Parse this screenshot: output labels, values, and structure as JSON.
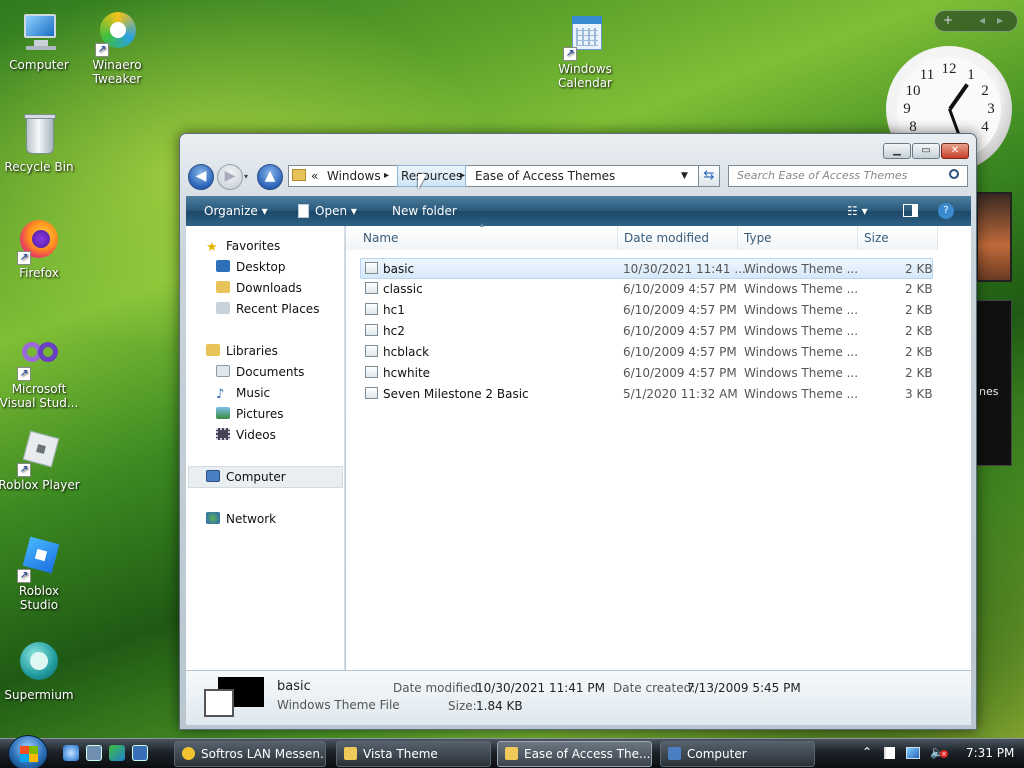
{
  "desktop": {
    "icons": [
      {
        "label": "Computer",
        "icon": "computer-icon"
      },
      {
        "label": "Winaero Tweaker",
        "icon": "winaero-icon"
      },
      {
        "label": "Windows Calendar",
        "icon": "calendar-icon"
      },
      {
        "label": "Recycle Bin",
        "icon": "recycle-bin-icon"
      },
      {
        "label": "Firefox",
        "icon": "firefox-icon"
      },
      {
        "label": "Microsoft Visual Stud...",
        "icon": "visual-studio-icon"
      },
      {
        "label": "Roblox Player",
        "icon": "roblox-player-icon"
      },
      {
        "label": "Roblox Studio",
        "icon": "roblox-studio-icon"
      },
      {
        "label": "Supermium",
        "icon": "supermium-icon"
      }
    ],
    "gadget_bar": {
      "add": "+",
      "prev": "◂",
      "next": "▸"
    },
    "clock_numbers": [
      "12",
      "1",
      "2",
      "3",
      "4",
      "8",
      "9",
      "10",
      "11"
    ],
    "side_gadget_text": "nes"
  },
  "window": {
    "caption_buttons": {
      "minimize": "▁",
      "maximize": "▭",
      "close": "✕"
    },
    "address": {
      "overflow": "«",
      "crumbs": [
        "Windows",
        "Resources",
        "Ease of Access Themes"
      ],
      "sep": "▸"
    },
    "search_placeholder": "Search Ease of Access Themes",
    "toolbar": {
      "organize": "Organize ▾",
      "open": "Open ▾",
      "new_folder": "New folder",
      "help": "?"
    },
    "nav": {
      "favorites": "Favorites",
      "favorites_items": [
        "Desktop",
        "Downloads",
        "Recent Places"
      ],
      "libraries": "Libraries",
      "libraries_items": [
        "Documents",
        "Music",
        "Pictures",
        "Videos"
      ],
      "computer": "Computer",
      "network": "Network"
    },
    "columns": [
      "Name",
      "Date modified",
      "Type",
      "Size"
    ],
    "files": [
      {
        "name": "basic",
        "date": "10/30/2021 11:41 ...",
        "type": "Windows Theme ...",
        "size": "2 KB"
      },
      {
        "name": "classic",
        "date": "6/10/2009 4:57 PM",
        "type": "Windows Theme ...",
        "size": "2 KB"
      },
      {
        "name": "hc1",
        "date": "6/10/2009 4:57 PM",
        "type": "Windows Theme ...",
        "size": "2 KB"
      },
      {
        "name": "hc2",
        "date": "6/10/2009 4:57 PM",
        "type": "Windows Theme ...",
        "size": "2 KB"
      },
      {
        "name": "hcblack",
        "date": "6/10/2009 4:57 PM",
        "type": "Windows Theme ...",
        "size": "2 KB"
      },
      {
        "name": "hcwhite",
        "date": "6/10/2009 4:57 PM",
        "type": "Windows Theme ...",
        "size": "2 KB"
      },
      {
        "name": "Seven Milestone 2 Basic",
        "date": "5/1/2020 11:32 AM",
        "type": "Windows Theme ...",
        "size": "3 KB"
      }
    ],
    "details": {
      "name": "basic",
      "type": "Windows Theme File",
      "modified_label": "Date modified:",
      "modified": "10/30/2021 11:41 PM",
      "created_label": "Date created:",
      "created": "7/13/2009 5:45 PM",
      "size_label": "Size:",
      "size": "1.84 KB"
    }
  },
  "taskbar": {
    "buttons": [
      {
        "label": "Softros LAN Messen...",
        "color": "#f2c230"
      },
      {
        "label": "Vista Theme",
        "color": "#f0c95a"
      },
      {
        "label": "Ease of Access The...",
        "color": "#f0c95a"
      },
      {
        "label": "Computer",
        "color": "#4b7fc4"
      }
    ],
    "time": "7:31 PM"
  },
  "colors": {
    "accent": "#2a63b8",
    "selection": "#d6e9f9"
  }
}
